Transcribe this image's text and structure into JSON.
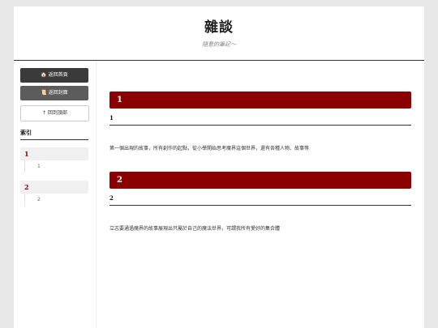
{
  "header": {
    "title": "雜談",
    "subtitle": "隨意的筆記～"
  },
  "sidebar": {
    "home_label": "🏠 返回首頁",
    "cover_label": "📜 返回封面",
    "top_label": "↑ 回到頂部",
    "index_title": "索引",
    "toc": [
      {
        "head": "1",
        "item": "1"
      },
      {
        "head": "2",
        "item": "2"
      }
    ]
  },
  "main": {
    "sections": [
      {
        "banner": "1",
        "subtitle": "1",
        "text": "第一個出現的故事，所有創作的起點，從小學開始思考魔界這個世界，還有各種人物、故事等"
      },
      {
        "banner": "2",
        "subtitle": "2",
        "text": "立志要通過魔界的故事展現出只屬於自己的魔法世界，可謂我所有愛好的集合體"
      }
    ]
  }
}
